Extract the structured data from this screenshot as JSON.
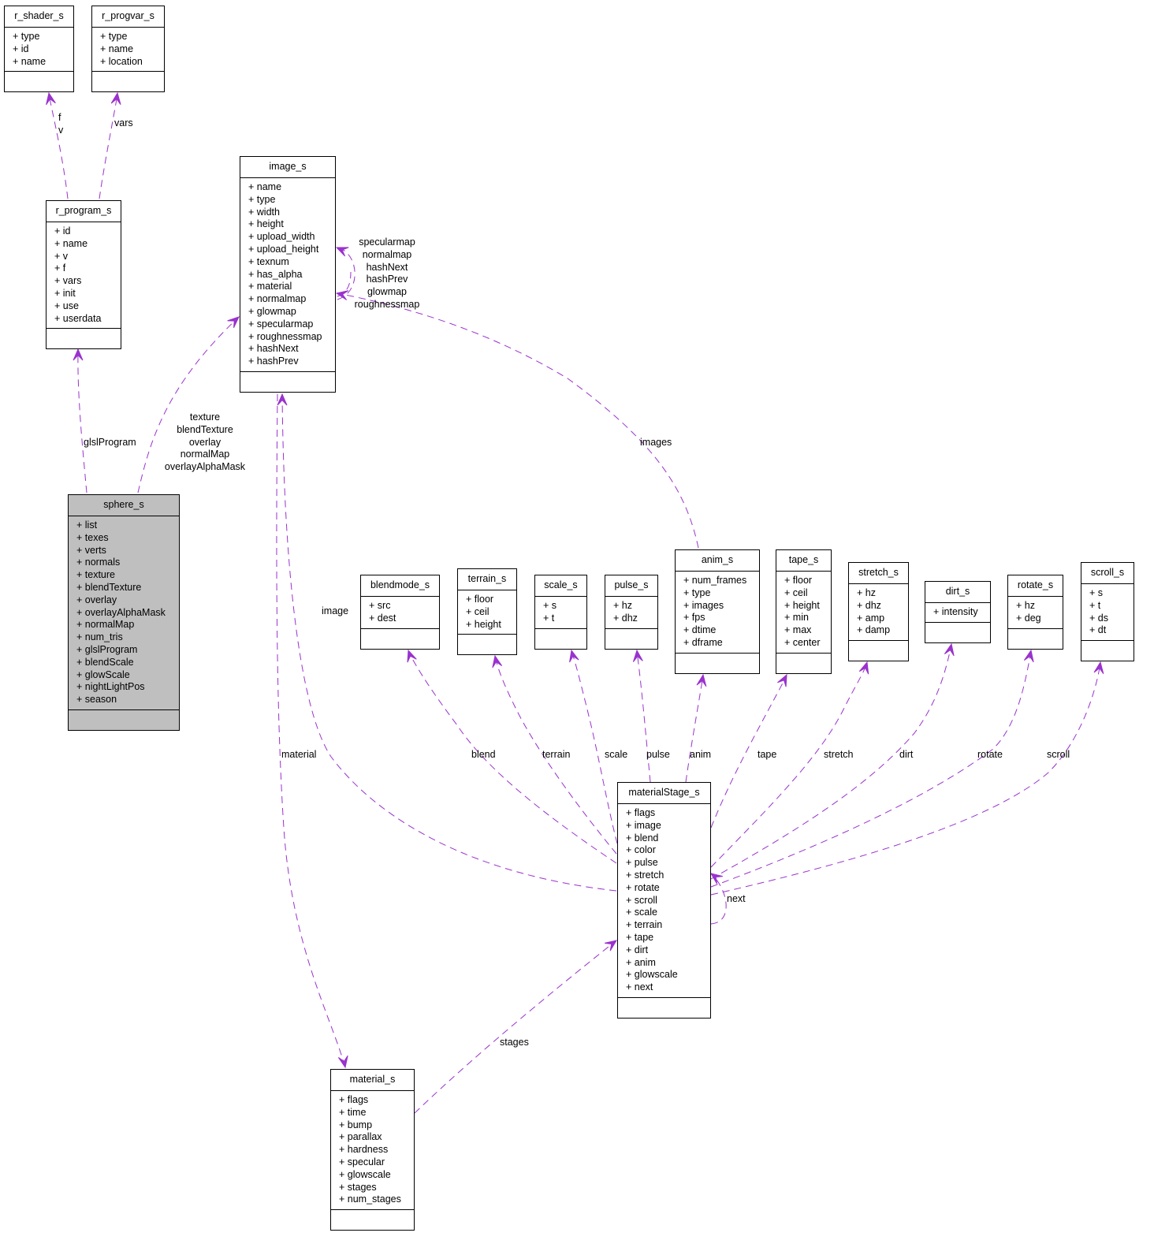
{
  "diagram": {
    "type": "collaboration-graph",
    "edge_color": "#9a32cd",
    "highlight_fill": "#bfbfbf",
    "classes": [
      {
        "id": "r_shader_s",
        "name": "r_shader_s",
        "attrs": [
          "type",
          "id",
          "name"
        ],
        "highlight": false
      },
      {
        "id": "r_progvar_s",
        "name": "r_progvar_s",
        "attrs": [
          "type",
          "name",
          "location"
        ],
        "highlight": false
      },
      {
        "id": "r_program_s",
        "name": "r_program_s",
        "attrs": [
          "id",
          "name",
          "v",
          "f",
          "vars",
          "init",
          "use",
          "userdata"
        ],
        "highlight": false
      },
      {
        "id": "image_s",
        "name": "image_s",
        "attrs": [
          "name",
          "type",
          "width",
          "height",
          "upload_width",
          "upload_height",
          "texnum",
          "has_alpha",
          "material",
          "normalmap",
          "glowmap",
          "specularmap",
          "roughnessmap",
          "hashNext",
          "hashPrev"
        ],
        "highlight": false
      },
      {
        "id": "sphere_s",
        "name": "sphere_s",
        "attrs": [
          "list",
          "texes",
          "verts",
          "normals",
          "texture",
          "blendTexture",
          "overlay",
          "overlayAlphaMask",
          "normalMap",
          "num_tris",
          "glslProgram",
          "blendScale",
          "glowScale",
          "nightLightPos",
          "season"
        ],
        "highlight": true
      },
      {
        "id": "blendmode_s",
        "name": "blendmode_s",
        "attrs": [
          "src",
          "dest"
        ],
        "highlight": false
      },
      {
        "id": "terrain_s",
        "name": "terrain_s",
        "attrs": [
          "floor",
          "ceil",
          "height"
        ],
        "highlight": false
      },
      {
        "id": "scale_s",
        "name": "scale_s",
        "attrs": [
          "s",
          "t"
        ],
        "highlight": false
      },
      {
        "id": "pulse_s",
        "name": "pulse_s",
        "attrs": [
          "hz",
          "dhz"
        ],
        "highlight": false
      },
      {
        "id": "anim_s",
        "name": "anim_s",
        "attrs": [
          "num_frames",
          "type",
          "images",
          "fps",
          "dtime",
          "dframe"
        ],
        "highlight": false
      },
      {
        "id": "tape_s",
        "name": "tape_s",
        "attrs": [
          "floor",
          "ceil",
          "height",
          "min",
          "max",
          "center"
        ],
        "highlight": false
      },
      {
        "id": "stretch_s",
        "name": "stretch_s",
        "attrs": [
          "hz",
          "dhz",
          "amp",
          "damp"
        ],
        "highlight": false
      },
      {
        "id": "dirt_s",
        "name": "dirt_s",
        "attrs": [
          "intensity"
        ],
        "highlight": false
      },
      {
        "id": "rotate_s",
        "name": "rotate_s",
        "attrs": [
          "hz",
          "deg"
        ],
        "highlight": false
      },
      {
        "id": "scroll_s",
        "name": "scroll_s",
        "attrs": [
          "s",
          "t",
          "ds",
          "dt"
        ],
        "highlight": false
      },
      {
        "id": "materialStage_s",
        "name": "materialStage_s",
        "attrs": [
          "flags",
          "image",
          "blend",
          "color",
          "pulse",
          "stretch",
          "rotate",
          "scroll",
          "scale",
          "terrain",
          "tape",
          "dirt",
          "anim",
          "glowscale",
          "next"
        ],
        "highlight": false
      },
      {
        "id": "material_s",
        "name": "material_s",
        "attrs": [
          "flags",
          "time",
          "bump",
          "parallax",
          "hardness",
          "specular",
          "glowscale",
          "stages",
          "num_stages"
        ],
        "highlight": false
      }
    ],
    "edges": [
      {
        "from": "r_program_s",
        "to": "r_shader_s",
        "labels": [
          "f",
          "v"
        ]
      },
      {
        "from": "r_program_s",
        "to": "r_progvar_s",
        "labels": [
          "vars"
        ]
      },
      {
        "from": "sphere_s",
        "to": "r_program_s",
        "labels": [
          "glslProgram"
        ]
      },
      {
        "from": "sphere_s",
        "to": "image_s",
        "labels": [
          "texture",
          "blendTexture",
          "overlay",
          "normalMap",
          "overlayAlphaMask"
        ]
      },
      {
        "from": "image_s",
        "to": "image_s",
        "labels": [
          "specularmap",
          "normalmap",
          "hashNext",
          "hashPrev",
          "glowmap",
          "roughnessmap"
        ]
      },
      {
        "from": "anim_s",
        "to": "image_s",
        "labels": [
          "images"
        ]
      },
      {
        "from": "materialStage_s",
        "to": "image_s",
        "labels": [
          "image"
        ]
      },
      {
        "from": "image_s",
        "to": "material_s",
        "labels": [
          "material"
        ]
      },
      {
        "from": "materialStage_s",
        "to": "blendmode_s",
        "labels": [
          "blend"
        ]
      },
      {
        "from": "materialStage_s",
        "to": "terrain_s",
        "labels": [
          "terrain"
        ]
      },
      {
        "from": "materialStage_s",
        "to": "scale_s",
        "labels": [
          "scale"
        ]
      },
      {
        "from": "materialStage_s",
        "to": "pulse_s",
        "labels": [
          "pulse"
        ]
      },
      {
        "from": "materialStage_s",
        "to": "anim_s",
        "labels": [
          "anim"
        ]
      },
      {
        "from": "materialStage_s",
        "to": "tape_s",
        "labels": [
          "tape"
        ]
      },
      {
        "from": "materialStage_s",
        "to": "stretch_s",
        "labels": [
          "stretch"
        ]
      },
      {
        "from": "materialStage_s",
        "to": "dirt_s",
        "labels": [
          "dirt"
        ]
      },
      {
        "from": "materialStage_s",
        "to": "rotate_s",
        "labels": [
          "rotate"
        ]
      },
      {
        "from": "materialStage_s",
        "to": "scroll_s",
        "labels": [
          "scroll"
        ]
      },
      {
        "from": "materialStage_s",
        "to": "materialStage_s",
        "labels": [
          "next"
        ]
      },
      {
        "from": "material_s",
        "to": "materialStage_s",
        "labels": [
          "stages"
        ]
      }
    ]
  }
}
